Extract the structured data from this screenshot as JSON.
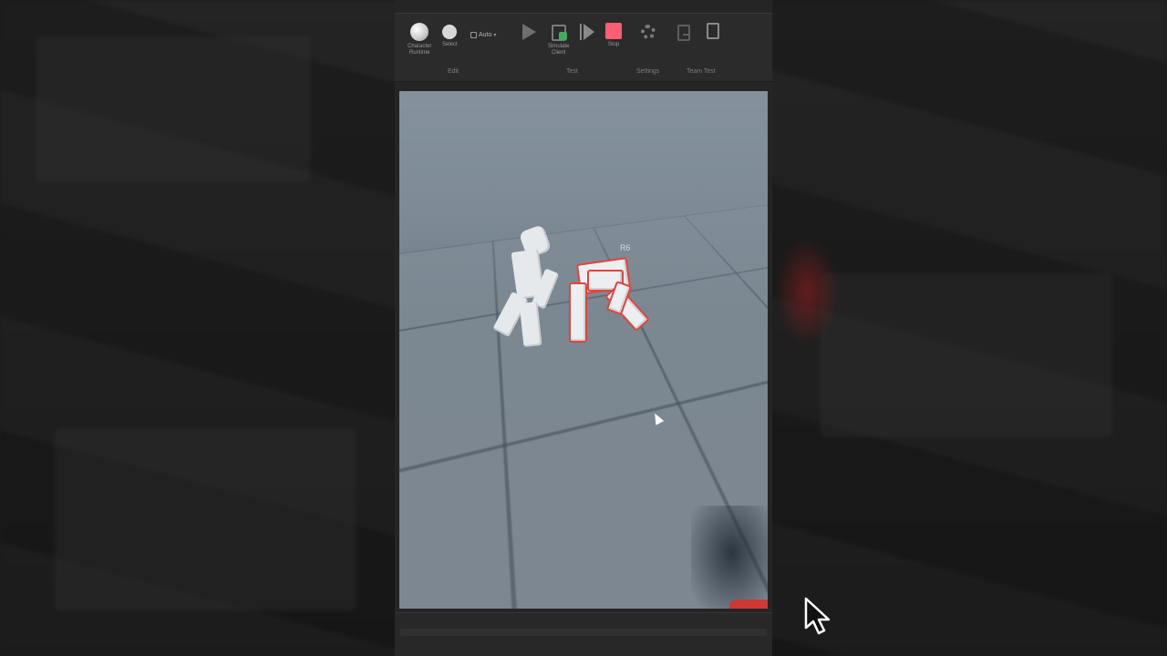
{
  "ribbon": {
    "buttons": [
      {
        "name": "character-runtime",
        "label": "Character\nRuntime"
      },
      {
        "name": "select",
        "label": "Select"
      },
      {
        "name": "play",
        "label": ""
      },
      {
        "name": "simulate-client",
        "label": "Simulate\nClient"
      },
      {
        "name": "play-here",
        "label": ""
      },
      {
        "name": "stop",
        "label": "Stop"
      },
      {
        "name": "settings",
        "label": ""
      },
      {
        "name": "ghost",
        "label": ""
      },
      {
        "name": "notes",
        "label": ""
      }
    ],
    "mode_select": {
      "label": "Auto"
    },
    "groups": {
      "edit": "Edit",
      "test": "Test",
      "settings": "Settings",
      "team": "Team Test"
    }
  },
  "viewport": {
    "rig_label": "R6",
    "selection_color": "#e2443b"
  },
  "colors": {
    "stop_accent": "#ff5d73",
    "sky": "#7f8c97",
    "floor": "#7b8892"
  }
}
